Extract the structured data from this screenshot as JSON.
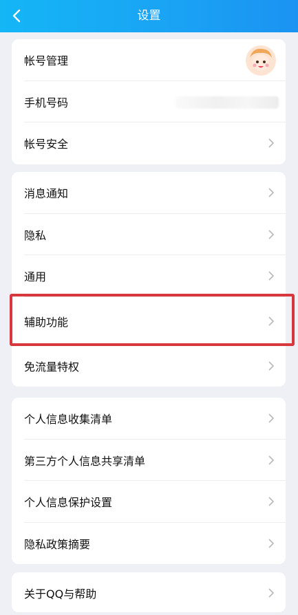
{
  "header": {
    "title": "设置",
    "back_icon": "chevron-left-icon"
  },
  "group1": {
    "items": [
      {
        "label": "帐号管理"
      },
      {
        "label": "手机号码"
      },
      {
        "label": "帐号安全"
      }
    ]
  },
  "group2": {
    "items": [
      {
        "label": "消息通知"
      },
      {
        "label": "隐私"
      },
      {
        "label": "通用"
      },
      {
        "label": "辅助功能"
      },
      {
        "label": "免流量特权"
      }
    ]
  },
  "group3": {
    "items": [
      {
        "label": "个人信息收集清单"
      },
      {
        "label": "第三方个人信息共享清单"
      },
      {
        "label": "个人信息保护设置"
      },
      {
        "label": "隐私政策摘要"
      }
    ]
  },
  "group4": {
    "items": [
      {
        "label": "关于QQ与帮助"
      }
    ]
  },
  "colors": {
    "accent": "#1aa2f4",
    "highlight": "#d8373d"
  }
}
